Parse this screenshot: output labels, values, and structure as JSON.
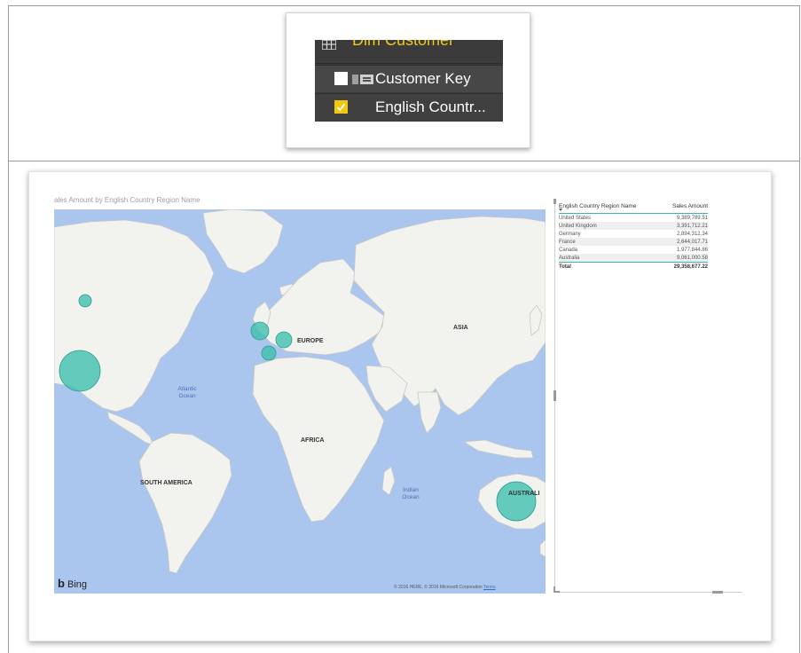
{
  "fields_pane": {
    "table_name": "Dim Customer",
    "fields": [
      {
        "label": "Customer Key",
        "checked": false
      },
      {
        "label": "English Countr...",
        "checked": true
      }
    ]
  },
  "map_visual": {
    "title": "ales Amount by English Country Region Name",
    "labels": {
      "europe": "EUROPE",
      "asia": "ASIA",
      "africa": "AFRICA",
      "south_america": "SOUTH AMERICA",
      "australia": "AUSTRALI",
      "atlantic_1": "Atlantic",
      "atlantic_2": "Ocean",
      "indian_1": "Indian",
      "indian_2": "Ocean"
    },
    "bing_label": "Bing",
    "attribution": "© 2016 HERE, © 2016 Microsoft Corporation",
    "terms": "Terms",
    "bubble_color": "#3cbfad"
  },
  "table_visual": {
    "columns": [
      "English Country Region Name",
      "Sales Amount"
    ],
    "rows": [
      {
        "country": "United States",
        "amount": "9,389,789.51"
      },
      {
        "country": "United Kingdom",
        "amount": "3,391,712.21"
      },
      {
        "country": "Germany",
        "amount": "2,894,312.34"
      },
      {
        "country": "France",
        "amount": "2,644,017.71"
      },
      {
        "country": "Canada",
        "amount": "1,977,844.86"
      },
      {
        "country": "Australia",
        "amount": "9,061,000.58"
      }
    ],
    "total_label": "Total",
    "total_amount": "29,358,677.22"
  }
}
